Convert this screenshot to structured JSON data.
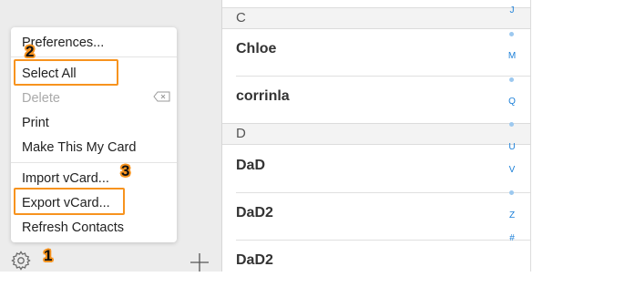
{
  "menu": {
    "items": [
      {
        "label": "Preferences..."
      },
      {
        "label": "Select All"
      },
      {
        "label": "Delete"
      },
      {
        "label": "Print"
      },
      {
        "label": "Make This My Card"
      },
      {
        "label": "Import vCard..."
      },
      {
        "label": "Export vCard..."
      },
      {
        "label": "Refresh Contacts"
      }
    ]
  },
  "steps": [
    "1",
    "2",
    "3"
  ],
  "contacts": {
    "sections": [
      {
        "letter": "C",
        "names": [
          "Chloe",
          "corrinla"
        ]
      },
      {
        "letter": "D",
        "names": [
          "DaD",
          "DaD2",
          "DaD2"
        ]
      }
    ]
  },
  "index": [
    "J",
    "M",
    "Q",
    "U",
    "V",
    "Z",
    "#"
  ],
  "colors": {
    "highlight": "#f7931e",
    "index": "#1a7fd8"
  }
}
